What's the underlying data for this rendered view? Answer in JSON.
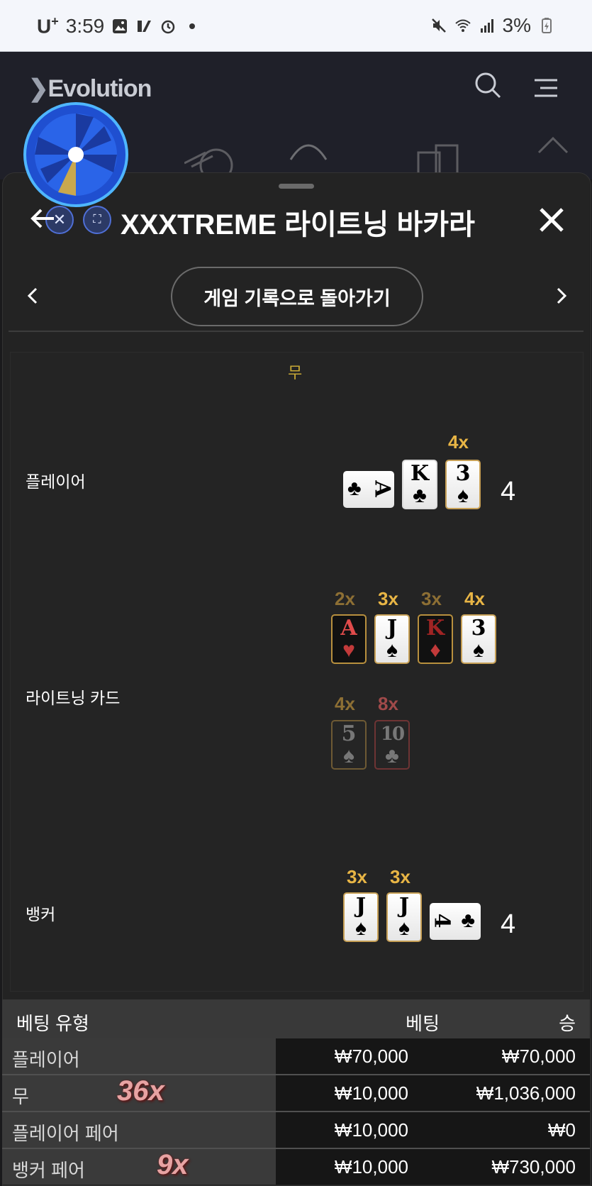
{
  "status_bar": {
    "carrier": "U",
    "carrier_sup": "+",
    "time": "3:59",
    "battery": "3%",
    "icons": [
      "gallery-icon",
      "app-icon",
      "alarm-icon",
      "dot-icon",
      "mute-icon",
      "wifi-icon",
      "signal-icon",
      "battery-icon"
    ]
  },
  "header": {
    "logo": "Evolution"
  },
  "panel": {
    "title": "XXXTREME 라이트닝 바카라",
    "history_button": "게임 기록으로 돌아가기"
  },
  "result": {
    "outcome": "무",
    "player": {
      "label": "플레이어",
      "total": "4",
      "cards": [
        {
          "rank": "A",
          "suit": "♣",
          "multiplier": ""
        },
        {
          "rank": "K",
          "suit": "♣",
          "multiplier": ""
        },
        {
          "rank": "3",
          "suit": "♠",
          "multiplier": "4x"
        }
      ]
    },
    "lightning": {
      "label": "라이트닝 카드",
      "row1": [
        {
          "rank": "A",
          "suit": "♥",
          "multiplier": "2x"
        },
        {
          "rank": "J",
          "suit": "♠",
          "multiplier": "3x"
        },
        {
          "rank": "K",
          "suit": "♦",
          "multiplier": "3x"
        },
        {
          "rank": "3",
          "suit": "♠",
          "multiplier": "4x"
        }
      ],
      "row2": [
        {
          "rank": "5",
          "suit": "♠",
          "multiplier": "4x"
        },
        {
          "rank": "10",
          "suit": "♣",
          "multiplier": "8x"
        }
      ]
    },
    "banker": {
      "label": "뱅커",
      "total": "4",
      "cards": [
        {
          "rank": "J",
          "suit": "♠",
          "multiplier": "3x"
        },
        {
          "rank": "J",
          "suit": "♠",
          "multiplier": "3x"
        },
        {
          "rank": "4",
          "suit": "♣",
          "multiplier": ""
        }
      ]
    }
  },
  "bet_table": {
    "headers": {
      "type": "베팅 유형",
      "bet": "베팅",
      "win": "승"
    },
    "rows": [
      {
        "type": "플레이어",
        "bet": "₩70,000",
        "win": "₩70,000",
        "badge": ""
      },
      {
        "type": "무",
        "bet": "₩10,000",
        "win": "₩1,036,000",
        "badge": "36x"
      },
      {
        "type": "플레이어 페어",
        "bet": "₩10,000",
        "win": "₩0",
        "badge": ""
      },
      {
        "type": "뱅커 페어",
        "bet": "₩10,000",
        "win": "₩730,000",
        "badge": "9x"
      }
    ]
  }
}
